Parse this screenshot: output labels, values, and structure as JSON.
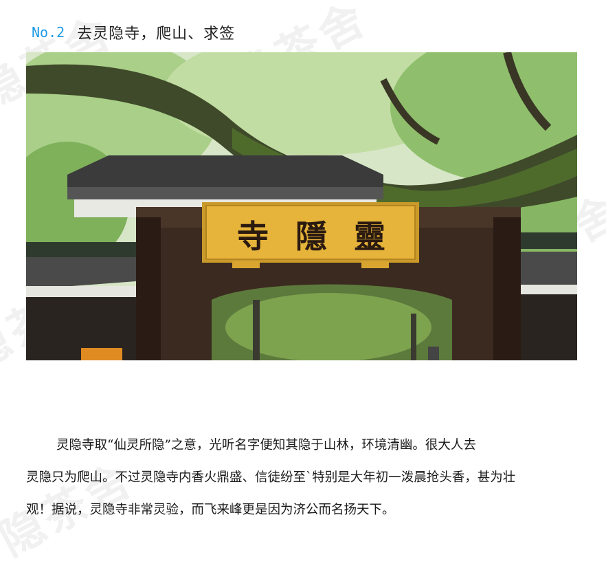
{
  "heading": {
    "number": "No.2",
    "title": "去灵隐寺，爬山、求签"
  },
  "watermark": "隐茶舍",
  "photo": {
    "plaque_chars": [
      "寺",
      "隱",
      "靈"
    ],
    "plaque_color": "#e6b43a"
  },
  "paragraph": {
    "line1": "灵隐寺取“仙灵所隐”之意，光听名字便知其隐于山林，环境清幽。很大人去",
    "line2": "灵隐只为爬山。不过灵隐寺内香火鼎盛、信徒纷至`特别是大年初一泼晨抢头香，甚为壮",
    "line3": "观！据说，灵隐寺非常灵验，而飞来峰更是因为济公而名扬天下。"
  },
  "colors": {
    "accent": "#1e9be6",
    "text": "#1a1a1a"
  }
}
